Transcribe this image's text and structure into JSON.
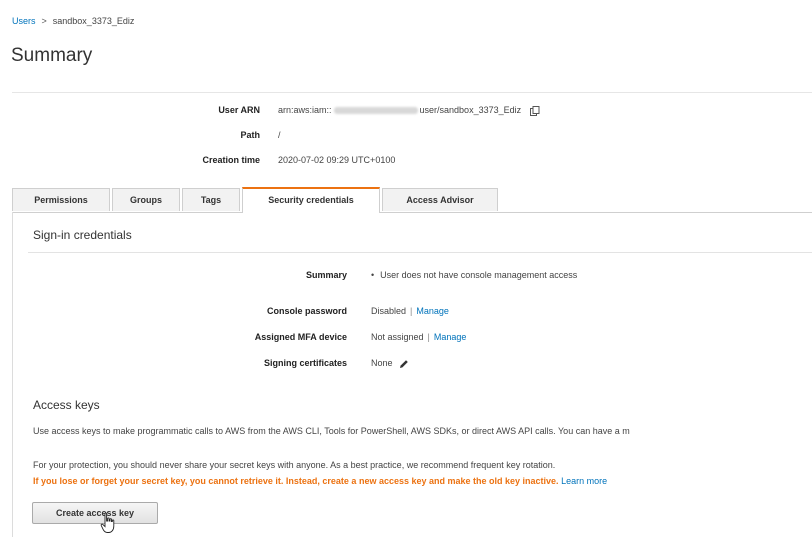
{
  "breadcrumb": {
    "root": "Users",
    "separator": ">",
    "current": "sandbox_3373_Ediz"
  },
  "page_title": "Summary",
  "summary": {
    "user_arn": {
      "label": "User ARN",
      "value_prefix": "arn:aws:iam::",
      "value_suffix": "user/sandbox_3373_Ediz"
    },
    "path": {
      "label": "Path",
      "value": "/"
    },
    "creation_time": {
      "label": "Creation time",
      "value": "2020-07-02 09:29 UTC+0100"
    }
  },
  "tabs": [
    {
      "label": "Permissions",
      "active": false
    },
    {
      "label": "Groups",
      "active": false
    },
    {
      "label": "Tags",
      "active": false
    },
    {
      "label": "Security credentials",
      "active": true
    },
    {
      "label": "Access Advisor",
      "active": false
    }
  ],
  "signin": {
    "title": "Sign-in credentials",
    "rows": {
      "summary": {
        "label": "Summary",
        "value": "User does not have console management access"
      },
      "console_password": {
        "label": "Console password",
        "value": "Disabled",
        "link": "Manage"
      },
      "mfa": {
        "label": "Assigned MFA device",
        "value": "Not assigned",
        "link": "Manage"
      },
      "signing": {
        "label": "Signing certificates",
        "value": "None"
      }
    }
  },
  "access_keys": {
    "title": "Access keys",
    "description": "Use access keys to make programmatic calls to AWS from the AWS CLI, Tools for PowerShell, AWS SDKs, or direct AWS API calls. You can have a m",
    "protection": "For your protection, you should never share your secret keys with anyone. As a best practice, we recommend frequent key rotation.",
    "warning": "If you lose or forget your secret key, you cannot retrieve it. Instead, create a new access key and make the old key inactive.",
    "learn_more": "Learn more",
    "create_button": "Create access key"
  },
  "colors": {
    "link": "#0073bb",
    "accent": "#ec7211",
    "text": "#333333"
  },
  "icons": {
    "copy": "copy-icon",
    "pencil": "pencil-icon",
    "cursor": "hand-cursor-icon"
  }
}
